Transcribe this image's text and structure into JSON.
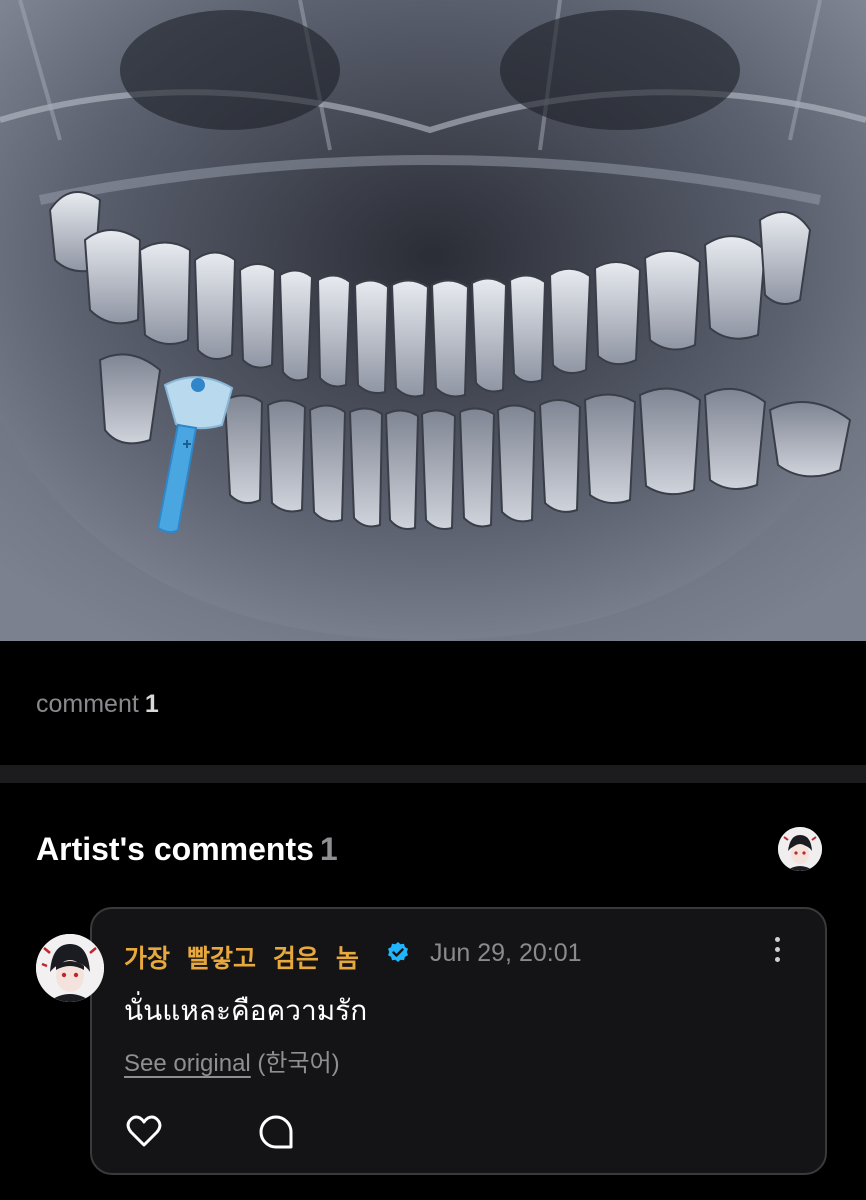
{
  "post": {
    "image": "dental-panoramic-xray-with-blue-implant",
    "comment_label": "comment",
    "comment_count": "1"
  },
  "artist_comments": {
    "title": "Artist's comments",
    "count": "1",
    "avatar": "artist-avatar-icon"
  },
  "comment": {
    "author": "가장 빨갛고 검은 놈",
    "verified_icon": "verified-badge-icon",
    "date": "Jun 29, 20:01",
    "text": "นั่นแหละคือความรัก",
    "see_original": "See original",
    "original_language": "(한국어)",
    "like_icon": "heart-icon",
    "reply_icon": "reply-bubble-icon",
    "more_icon": "more-vertical-icon"
  },
  "colors": {
    "background": "#000000",
    "author": "#e7a83d",
    "verified": "#1fb6ff",
    "card_border": "#3a3a3c"
  }
}
